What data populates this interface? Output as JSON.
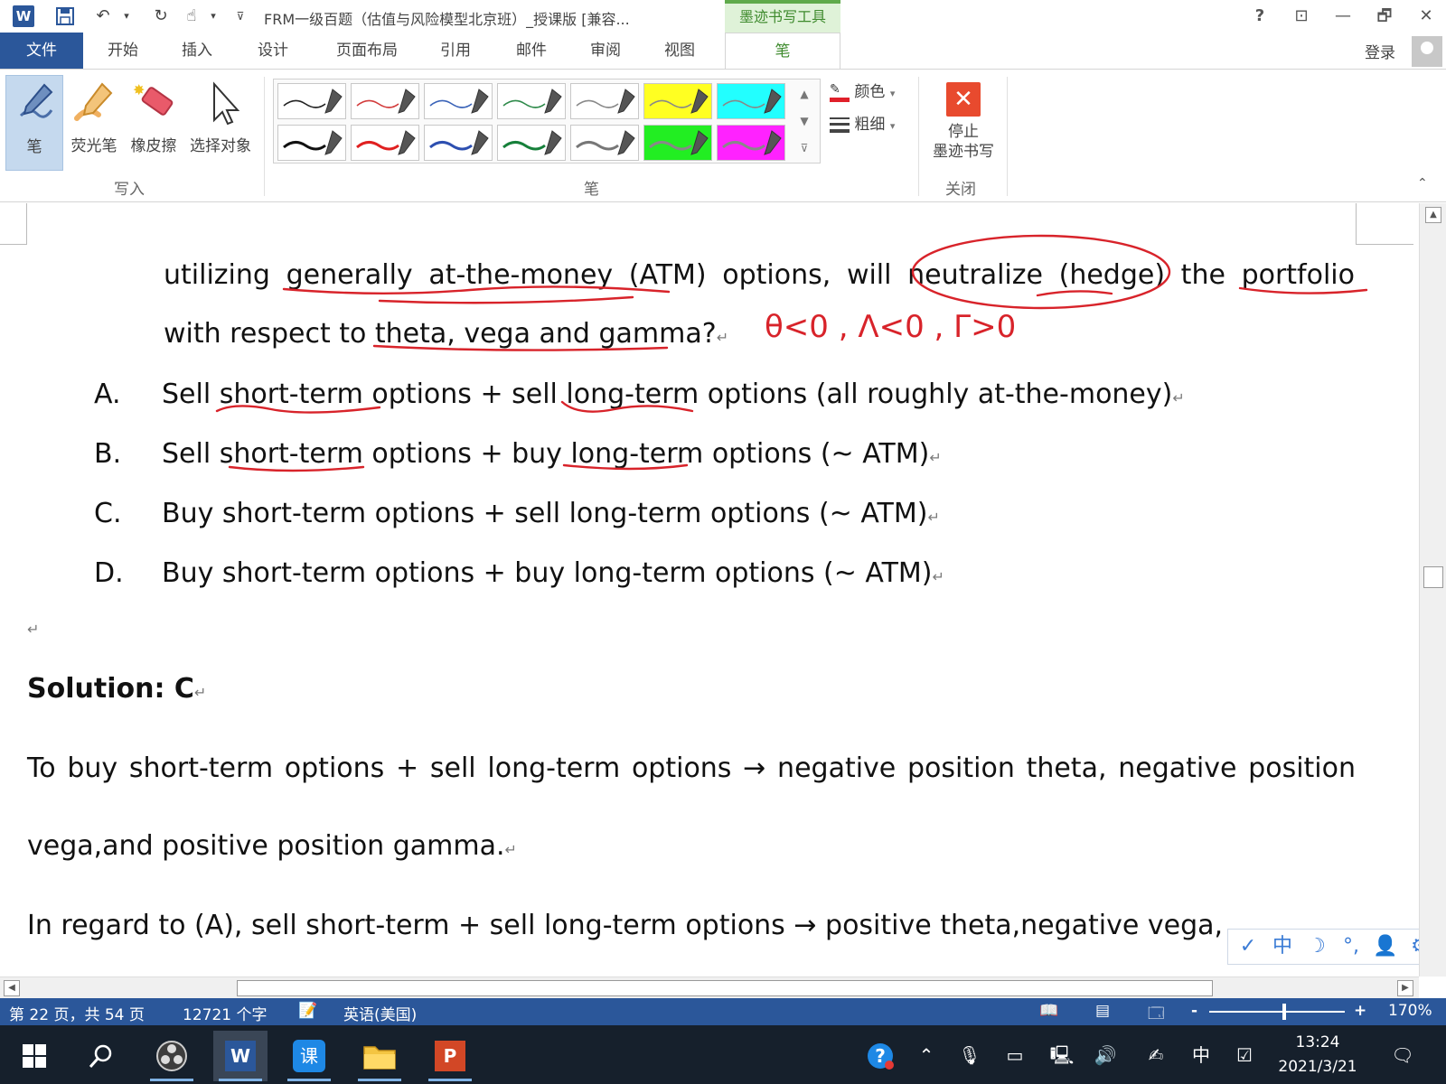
{
  "titlebar": {
    "app_letter": "W",
    "title": "FRM一级百题（估值与风险模型北京班）_授课版 [兼容...",
    "context_tab": "墨迹书写工具",
    "help": "?",
    "minimize": "—",
    "restore": "🗗",
    "close": "✕",
    "ribbon_display": "⊡"
  },
  "tabs": {
    "items": [
      "文件",
      "开始",
      "插入",
      "设计",
      "页面布局",
      "引用",
      "邮件",
      "审阅",
      "视图"
    ],
    "active": "笔",
    "login": "登录"
  },
  "ribbon": {
    "write_group": {
      "label": "写入",
      "buttons": [
        "笔",
        "荧光笔",
        "橡皮擦",
        "选择对象"
      ]
    },
    "pen_group": {
      "label": "笔",
      "color_label": "颜色",
      "weight_label": "粗细"
    },
    "close_group": {
      "label": "关闭",
      "stop_line1": "停止",
      "stop_line2": "墨迹书写"
    },
    "pen_swatches": [
      {
        "stroke": "#222222",
        "bg": "#ffffff"
      },
      {
        "stroke": "#d23b3b",
        "bg": "#ffffff"
      },
      {
        "stroke": "#3a63b8",
        "bg": "#ffffff"
      },
      {
        "stroke": "#2e8a4a",
        "bg": "#ffffff"
      },
      {
        "stroke": "#888888",
        "bg": "#ffffff"
      },
      {
        "stroke": "#888888",
        "bg": "#ffff22"
      },
      {
        "stroke": "#888888",
        "bg": "#22ffff"
      },
      {
        "stroke": "#111111",
        "bg": "#ffffff"
      },
      {
        "stroke": "#e02020",
        "bg": "#ffffff"
      },
      {
        "stroke": "#2d4fb0",
        "bg": "#ffffff"
      },
      {
        "stroke": "#16803a",
        "bg": "#ffffff"
      },
      {
        "stroke": "#777777",
        "bg": "#ffffff"
      },
      {
        "stroke": "#888888",
        "bg": "#22ee22"
      },
      {
        "stroke": "#888888",
        "bg": "#ff22ff"
      }
    ]
  },
  "document": {
    "question_line1": "utilizing generally at-the-money (ATM) options, will neutralize (hedge) the portfolio",
    "question_line2": "with respect to theta, vega and gamma?",
    "options": [
      {
        "letter": "A.",
        "text": "Sell short-term options + sell long-term options (all roughly at-the-money)"
      },
      {
        "letter": "B.",
        "text": "Sell short-term options + buy long-term options (~ ATM)"
      },
      {
        "letter": "C.",
        "text": "Buy short-term options + sell long-term options (~ ATM)"
      },
      {
        "letter": "D.",
        "text": "Buy short-term options + buy long-term options (~ ATM)"
      }
    ],
    "para_mark": "↵",
    "solution": "Solution: C",
    "explanation_line1": "To buy short-term options + sell long-term options  →  negative position theta, negative position",
    "explanation_line2": "vega,and positive position gamma.",
    "explanation_line3": "In regard to (A), sell short-term + sell long-term options  →  positive theta,negative vega,",
    "handwriting": "θ<0 ,  Λ<0 ,  Γ>0"
  },
  "ime": [
    "✓",
    "中",
    "☽",
    "°,",
    "👤",
    "⚙"
  ],
  "status": {
    "page": "第 22 页，共 54 页",
    "words": "12721 个字",
    "language": "英语(美国)",
    "zoom_minus": "-",
    "zoom_plus": "+",
    "zoom": "170%",
    "zoom_level": 0.55
  },
  "taskbar": {
    "time": "13:24",
    "date": "2021/3/21",
    "ime_lang": "中"
  }
}
